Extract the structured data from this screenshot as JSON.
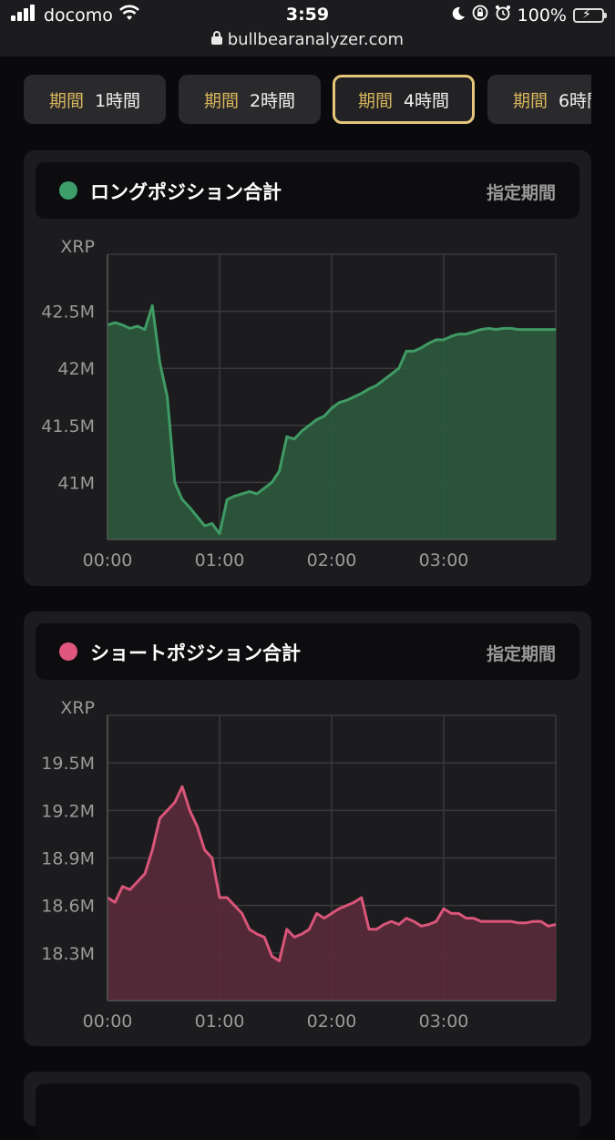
{
  "status_bar": {
    "carrier": "docomo",
    "time": "3:59",
    "url": "bullbearanalyzer.com",
    "battery": "100%"
  },
  "tabs": [
    {
      "key": "期間",
      "value": "1時間",
      "active": false
    },
    {
      "key": "期間",
      "value": "2時間",
      "active": false
    },
    {
      "key": "期間",
      "value": "4時間",
      "active": true
    },
    {
      "key": "期間",
      "value": "6時間",
      "active": false
    }
  ],
  "charts": [
    {
      "title": "ロングポジション合計",
      "period_label": "指定期間",
      "color": "#3f9a64",
      "fill": "#2c5a3c",
      "dot_color": "#3d9e6a",
      "chart_data": {
        "type": "area",
        "title": "ロングポジション合計",
        "ylabel": "XRP",
        "y_ticks": [
          "42.5M",
          "42M",
          "41.5M",
          "41M"
        ],
        "y_tick_values": [
          42.5,
          42.0,
          41.5,
          41.0
        ],
        "x_ticks": [
          "00:00",
          "01:00",
          "02:00",
          "03:00"
        ],
        "x_tick_values": [
          0,
          60,
          120,
          180
        ],
        "xlim": [
          0,
          240
        ],
        "ylim": [
          40.5,
          43.0
        ],
        "grid": true,
        "series": [
          {
            "x": [
              0,
              4,
              8,
              12,
              16,
              20,
              24,
              28,
              32,
              36,
              40,
              44,
              48,
              52,
              56,
              60,
              64,
              68,
              72,
              76,
              80,
              84,
              88,
              92,
              96,
              100,
              104,
              108,
              112,
              116,
              120,
              124,
              128,
              132,
              136,
              140,
              144,
              148,
              152,
              156,
              160,
              164,
              168,
              172,
              176,
              180,
              184,
              188,
              192,
              196,
              200,
              204,
              208,
              212,
              216,
              220,
              224,
              228,
              232,
              236,
              240
            ],
            "values": [
              42.38,
              42.4,
              42.38,
              42.35,
              42.37,
              42.34,
              42.55,
              42.05,
              41.75,
              41.0,
              40.85,
              40.78,
              40.7,
              40.62,
              40.64,
              40.55,
              40.85,
              40.88,
              40.9,
              40.92,
              40.9,
              40.95,
              41.0,
              41.1,
              41.4,
              41.38,
              41.45,
              41.5,
              41.55,
              41.58,
              41.65,
              41.7,
              41.72,
              41.75,
              41.78,
              41.82,
              41.85,
              41.9,
              41.95,
              42.0,
              42.15,
              42.15,
              42.18,
              42.22,
              42.25,
              42.25,
              42.28,
              42.3,
              42.3,
              42.32,
              42.34,
              42.35,
              42.34,
              42.35,
              42.35,
              42.34,
              42.34,
              42.34,
              42.34,
              42.34,
              42.34
            ]
          }
        ]
      }
    },
    {
      "title": "ショートポジション合計",
      "period_label": "指定期間",
      "color": "#d9557a",
      "fill": "#5a2a3a",
      "dot_color": "#e0577e",
      "chart_data": {
        "type": "area",
        "title": "ショートポジション合計",
        "ylabel": "XRP",
        "y_ticks": [
          "19.5M",
          "19.2M",
          "18.9M",
          "18.6M",
          "18.3M"
        ],
        "y_tick_values": [
          19.5,
          19.2,
          18.9,
          18.6,
          18.3
        ],
        "x_ticks": [
          "00:00",
          "01:00",
          "02:00",
          "03:00"
        ],
        "x_tick_values": [
          0,
          60,
          120,
          180
        ],
        "xlim": [
          0,
          240
        ],
        "ylim": [
          18.0,
          19.8
        ],
        "grid": true,
        "series": [
          {
            "x": [
              0,
              4,
              8,
              12,
              16,
              20,
              24,
              28,
              32,
              36,
              40,
              44,
              48,
              52,
              56,
              60,
              64,
              68,
              72,
              76,
              80,
              84,
              88,
              92,
              96,
              100,
              104,
              108,
              112,
              116,
              120,
              124,
              128,
              132,
              136,
              140,
              144,
              148,
              152,
              156,
              160,
              164,
              168,
              172,
              176,
              180,
              184,
              188,
              192,
              196,
              200,
              204,
              208,
              212,
              216,
              220,
              224,
              228,
              232,
              236,
              240
            ],
            "values": [
              18.65,
              18.62,
              18.72,
              18.7,
              18.75,
              18.8,
              18.95,
              19.15,
              19.2,
              19.25,
              19.35,
              19.2,
              19.1,
              18.95,
              18.9,
              18.65,
              18.65,
              18.6,
              18.55,
              18.45,
              18.42,
              18.4,
              18.28,
              18.25,
              18.45,
              18.4,
              18.42,
              18.45,
              18.55,
              18.52,
              18.55,
              18.58,
              18.6,
              18.62,
              18.65,
              18.45,
              18.45,
              18.48,
              18.5,
              18.48,
              18.52,
              18.5,
              18.47,
              18.48,
              18.5,
              18.58,
              18.55,
              18.55,
              18.52,
              18.52,
              18.5,
              18.5,
              18.5,
              18.5,
              18.5,
              18.49,
              18.49,
              18.5,
              18.5,
              18.47,
              18.48
            ]
          }
        ]
      }
    }
  ]
}
